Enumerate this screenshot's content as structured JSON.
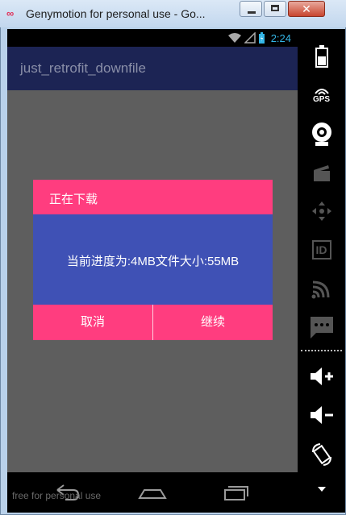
{
  "window": {
    "title": "Genymotion for personal use - Go...",
    "icon": "genymotion-logo-icon",
    "buttons": [
      "minimize-icon",
      "maximize-icon",
      "close-icon"
    ],
    "close_glyph": "✕"
  },
  "statusbar": {
    "time": "2:24",
    "icons": [
      "wifi-icon",
      "no-signal-icon",
      "battery-charging-icon"
    ],
    "accent": "#33b5e5"
  },
  "app": {
    "title": "just_retrofit_downfile",
    "actionbar_color": "#1c2454",
    "background_color": "#5e5e5e"
  },
  "dialog": {
    "title": "正在下载",
    "message": "当前进度为:4MB文件大小:55MB",
    "cancel_label": "取消",
    "continue_label": "继续",
    "header_color": "#ff3d7f",
    "body_color": "#3f51b5"
  },
  "navbar": {
    "buttons": [
      "back-icon",
      "home-icon",
      "recent-apps-icon"
    ],
    "watermark": "free for personal use"
  },
  "sidebar": {
    "items": [
      "battery-icon",
      "gps-icon",
      "camera-icon",
      "video-capture-icon",
      "dpad-icon",
      "device-id-icon",
      "cast-icon",
      "sms-icon",
      "volume-up-icon",
      "volume-down-icon",
      "rotate-icon",
      "more-icon"
    ],
    "gps_label": "GPS",
    "id_label": "ID"
  }
}
